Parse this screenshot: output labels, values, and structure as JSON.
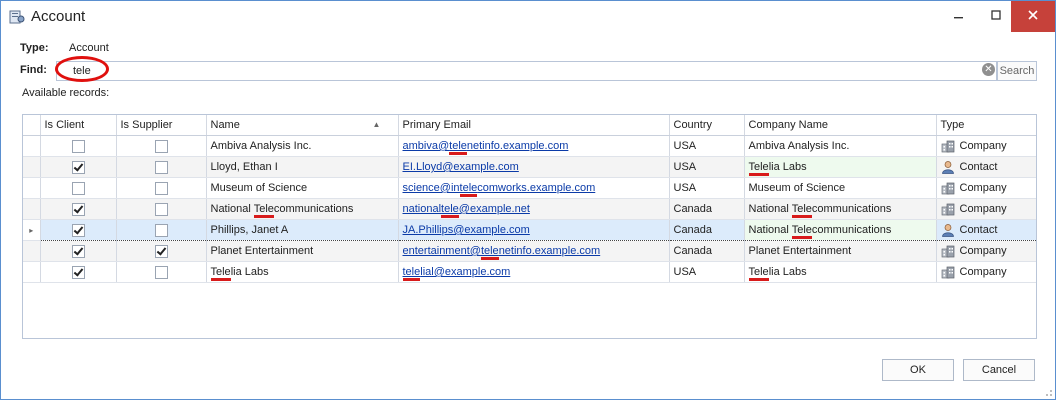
{
  "window": {
    "title": "Account"
  },
  "type_row": {
    "label": "Type:",
    "value": "Account"
  },
  "find": {
    "label": "Find:",
    "value": "tele",
    "search_label": "Search"
  },
  "available_label": "Available records:",
  "grid": {
    "columns": [
      "Is Client",
      "Is Supplier",
      "Name",
      "Primary Email",
      "Country",
      "Company Name",
      "Type"
    ],
    "sort_column": "Name",
    "rows": [
      {
        "is_client": false,
        "is_supplier": false,
        "name": "Ambiva Analysis Inc.",
        "email": "ambiva@telenetinfo.example.com",
        "country": "USA",
        "company": "Ambiva Analysis Inc.",
        "type": "Company",
        "type_icon": "company-icon"
      },
      {
        "is_client": true,
        "is_supplier": false,
        "name": "Lloyd, Ethan I",
        "email": "EI.Lloyd@example.com",
        "country": "USA",
        "company": "Telelia Labs",
        "type": "Contact",
        "type_icon": "contact-icon"
      },
      {
        "is_client": false,
        "is_supplier": false,
        "name": "Museum of Science",
        "email": "science@intelecomworks.example.com",
        "country": "USA",
        "company": "Museum of Science",
        "type": "Company",
        "type_icon": "company-icon"
      },
      {
        "is_client": true,
        "is_supplier": false,
        "name": "National Telecommunications",
        "email": "nationaltele@example.net",
        "country": "Canada",
        "company": "National Telecommunications",
        "type": "Company",
        "type_icon": "company-icon"
      },
      {
        "is_client": true,
        "is_supplier": false,
        "name": "Phillips, Janet A",
        "email": "JA.Phillips@example.com",
        "country": "Canada",
        "company": "National Telecommunications",
        "type": "Contact",
        "type_icon": "contact-icon"
      },
      {
        "is_client": true,
        "is_supplier": true,
        "name": "Planet Entertainment",
        "email": "entertainment@telenetinfo.example.com",
        "country": "Canada",
        "company": "Planet Entertainment",
        "type": "Company",
        "type_icon": "company-icon"
      },
      {
        "is_client": true,
        "is_supplier": false,
        "name": "Telelia Labs",
        "email": "telelial@example.com",
        "country": "USA",
        "company": "Telelia Labs",
        "type": "Company",
        "type_icon": "company-icon"
      }
    ],
    "selected_row": 4
  },
  "buttons": {
    "ok": "OK",
    "cancel": "Cancel"
  },
  "colors": {
    "close_button": "#c6413a",
    "highlight": "#d81b1b",
    "selection": "#dcebfb",
    "link": "#0b3ba8"
  }
}
